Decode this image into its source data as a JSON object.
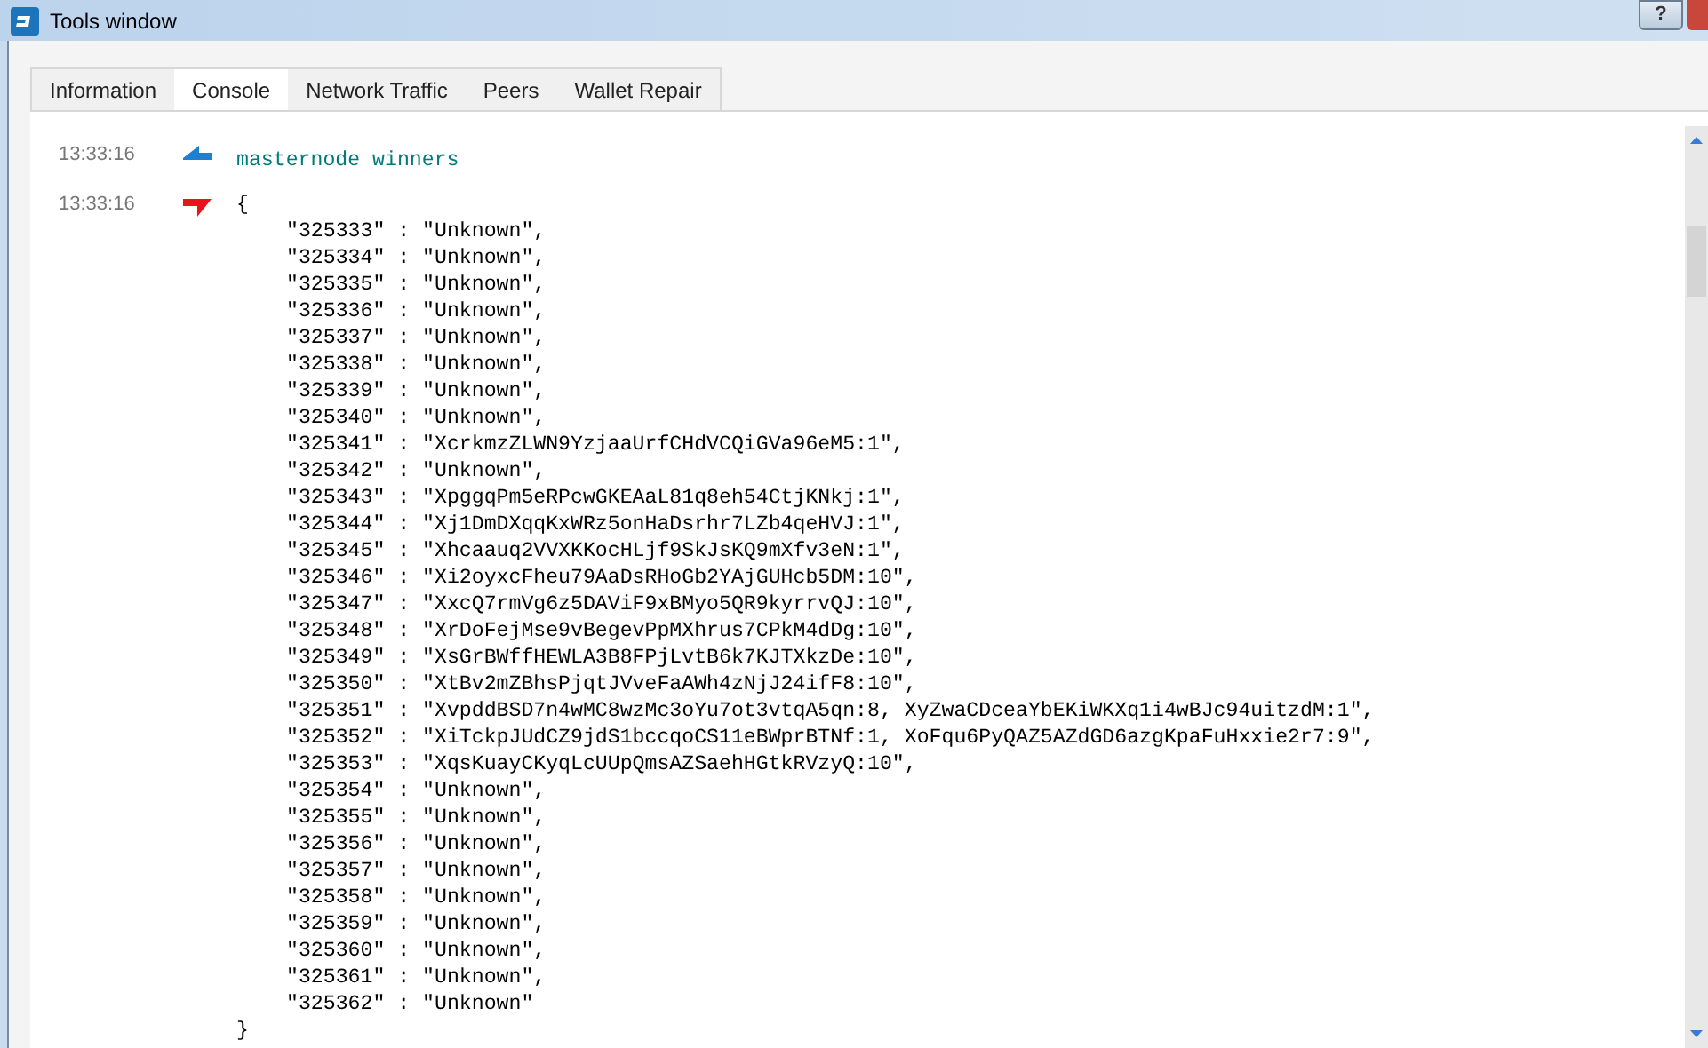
{
  "window": {
    "title": "Tools window",
    "help_button": "?"
  },
  "tabs": [
    {
      "label": "Information",
      "selected": false
    },
    {
      "label": "Console",
      "selected": true
    },
    {
      "label": "Network Traffic",
      "selected": false
    },
    {
      "label": "Peers",
      "selected": false
    },
    {
      "label": "Wallet Repair",
      "selected": false
    }
  ],
  "console": {
    "messages": [
      {
        "time": "13:33:16",
        "kind": "request",
        "lines": [
          "masternode winners"
        ]
      },
      {
        "time": "13:33:16",
        "kind": "reply",
        "open": "{",
        "close": "}",
        "lines": [
          "\"325333\" : \"Unknown\",",
          "\"325334\" : \"Unknown\",",
          "\"325335\" : \"Unknown\",",
          "\"325336\" : \"Unknown\",",
          "\"325337\" : \"Unknown\",",
          "\"325338\" : \"Unknown\",",
          "\"325339\" : \"Unknown\",",
          "\"325340\" : \"Unknown\",",
          "\"325341\" : \"XcrkmzZLWN9YzjaaUrfCHdVCQiGVa96eM5:1\",",
          "\"325342\" : \"Unknown\",",
          "\"325343\" : \"XpggqPm5eRPcwGKEAaL81q8eh54CtjKNkj:1\",",
          "\"325344\" : \"Xj1DmDXqqKxWRz5onHaDsrhr7LZb4qeHVJ:1\",",
          "\"325345\" : \"Xhcaauq2VVXKKocHLjf9SkJsKQ9mXfv3eN:1\",",
          "\"325346\" : \"Xi2oyxcFheu79AaDsRHoGb2YAjGUHcb5DM:10\",",
          "\"325347\" : \"XxcQ7rmVg6z5DAViF9xBMyo5QR9kyrrvQJ:10\",",
          "\"325348\" : \"XrDoFejMse9vBegevPpMXhrus7CPkM4dDg:10\",",
          "\"325349\" : \"XsGrBWffHEWLA3B8FPjLvtB6k7KJTXkzDe:10\",",
          "\"325350\" : \"XtBv2mZBhsPjqtJVveFaAWh4zNjJ24ifF8:10\",",
          "\"325351\" : \"XvpddBSD7n4wMC8wzMc3oYu7ot3vtqA5qn:8, XyZwaCDceaYbEKiWKXq1i4wBJc94uitzdM:1\",",
          "\"325352\" : \"XiTckpJUdCZ9jdS1bccqoCS11eBWprBTNf:1, XoFqu6PyQAZ5AZdGD6azgKpaFuHxxie2r7:9\",",
          "\"325353\" : \"XqsKuayCKyqLcUUpQmsAZSaehHGtkRVzyQ:10\",",
          "\"325354\" : \"Unknown\",",
          "\"325355\" : \"Unknown\",",
          "\"325356\" : \"Unknown\",",
          "\"325357\" : \"Unknown\",",
          "\"325358\" : \"Unknown\",",
          "\"325359\" : \"Unknown\",",
          "\"325360\" : \"Unknown\",",
          "\"325361\" : \"Unknown\",",
          "\"325362\" : \"Unknown\""
        ]
      }
    ]
  }
}
